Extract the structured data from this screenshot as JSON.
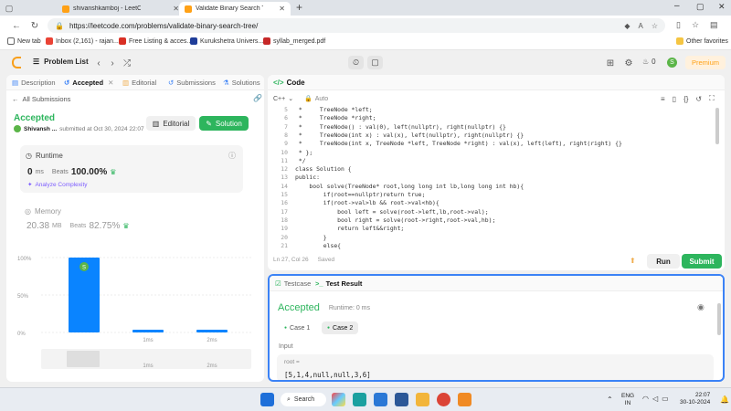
{
  "browser": {
    "tabs": [
      {
        "title": "shivanshkamboj - LeetCode Profi",
        "active": false
      },
      {
        "title": "Validate Binary Search Tree - Leet",
        "active": true
      }
    ],
    "new_tab": "+",
    "url": "https://leetcode.com/problems/validate-binary-search-tree/",
    "bookmarks": [
      "New tab",
      "Inbox (2,161) - rajan...",
      "Free Listing & acces...",
      "Kurukshetra Univers...",
      "syllab_merged.pdf"
    ],
    "other_favorites": "Other favorites"
  },
  "lc_nav": {
    "problem_list": "Problem List",
    "streak": "0",
    "avatar_letter": "S",
    "premium": "Premium"
  },
  "left": {
    "tabs": [
      "Description",
      "Accepted",
      "Editorial",
      "Submissions",
      "Solutions"
    ],
    "all_submissions": "All Submissions",
    "status": "Accepted",
    "user": "Shivansh ...",
    "submitted": "submitted at Oct 30, 2024 22:07",
    "editorial_btn": "Editorial",
    "solution_btn": "Solution",
    "runtime": {
      "label": "Runtime",
      "value": "0",
      "unit": "ms",
      "beats_label": "Beats",
      "beats": "100.00%",
      "analyze": "Analyze Complexity"
    },
    "memory": {
      "label": "Memory",
      "value": "20.38",
      "unit": "MB",
      "beats_label": "Beats",
      "beats": "82.75%"
    },
    "chart_axis": [
      "100%",
      "50%",
      "0%"
    ],
    "chart_ticks": [
      "1ms",
      "2ms"
    ],
    "chart_ticks_bottom": [
      "1ms",
      "2ms"
    ],
    "marker": "S"
  },
  "chart_data": {
    "type": "bar",
    "categories": [
      "0ms",
      "1ms",
      "2ms"
    ],
    "values": [
      100,
      3,
      3
    ],
    "ylim": [
      0,
      100
    ],
    "xlabel": "",
    "ylabel": ""
  },
  "code": {
    "title": "Code",
    "language": "C++",
    "mode": "Auto",
    "lines": [
      {
        "n": "5",
        "t": " *     TreeNode *left;"
      },
      {
        "n": "6",
        "t": " *     TreeNode *right;"
      },
      {
        "n": "7",
        "t": " *     TreeNode() : val(0), left(nullptr), right(nullptr) {}"
      },
      {
        "n": "8",
        "t": " *     TreeNode(int x) : val(x), left(nullptr), right(nullptr) {}"
      },
      {
        "n": "9",
        "t": " *     TreeNode(int x, TreeNode *left, TreeNode *right) : val(x), left(left), right(right) {}"
      },
      {
        "n": "10",
        "t": " * };"
      },
      {
        "n": "11",
        "t": " */"
      },
      {
        "n": "12",
        "t": "class Solution {"
      },
      {
        "n": "13",
        "t": "public:"
      },
      {
        "n": "14",
        "t": "    bool solve(TreeNode* root,long long int lb,long long int hb){"
      },
      {
        "n": "15",
        "t": "        if(root==nullptr)return true;"
      },
      {
        "n": "16",
        "t": "        if(root->val>lb && root->val<hb){"
      },
      {
        "n": "17",
        "t": "            bool left = solve(root->left,lb,root->val);"
      },
      {
        "n": "18",
        "t": "            bool right = solve(root->right,root->val,hb);"
      },
      {
        "n": "19",
        "t": "            return left&&right;"
      },
      {
        "n": "20",
        "t": "        }"
      },
      {
        "n": "21",
        "t": "        else{"
      }
    ],
    "cursor": "Ln 27, Col 26",
    "saved": "Saved",
    "run": "Run",
    "submit": "Submit"
  },
  "result": {
    "tab_testcase": "Testcase",
    "tab_result": "Test Result",
    "status": "Accepted",
    "runtime": "Runtime: 0 ms",
    "cases": [
      "Case 1",
      "Case 2"
    ],
    "input_label": "Input",
    "var_name": "root =",
    "value": "[5,1,4,null,null,3,6]"
  },
  "taskbar": {
    "search": "Search",
    "lang": "ENG",
    "region": "IN",
    "time": "22:07",
    "date": "30-10-2024"
  },
  "colors": {
    "accepted": "#2db55d",
    "bar": "#0a84ff",
    "premium": "#ffa116"
  }
}
